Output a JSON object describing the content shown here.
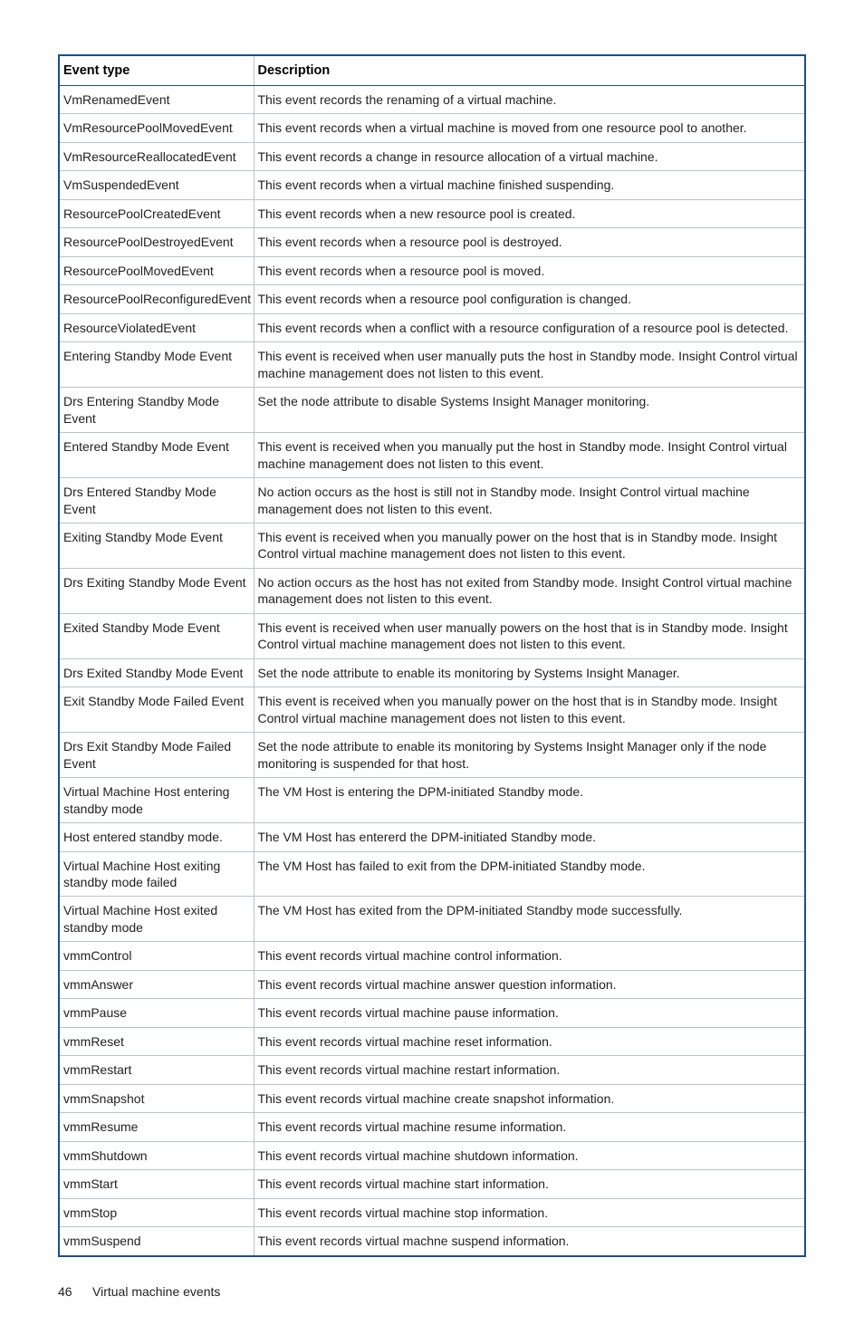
{
  "table": {
    "headers": {
      "event_type": "Event type",
      "description": "Description"
    },
    "rows": [
      {
        "event_type": "VmRenamedEvent",
        "description": "This event records the renaming of a virtual machine."
      },
      {
        "event_type": "VmResourcePoolMovedEvent",
        "description": "This event records when a virtual machine is moved from one resource pool to another."
      },
      {
        "event_type": "VmResourceReallocatedEvent",
        "description": "This event records a change in resource allocation of a virtual machine."
      },
      {
        "event_type": "VmSuspendedEvent",
        "description": "This event records when a virtual machine finished suspending."
      },
      {
        "event_type": "ResourcePoolCreatedEvent",
        "description": "This event records when a new resource pool is created."
      },
      {
        "event_type": "ResourcePoolDestroyedEvent",
        "description": "This event records when a resource pool is destroyed."
      },
      {
        "event_type": "ResourcePoolMovedEvent",
        "description": "This event records when a resource pool is moved."
      },
      {
        "event_type": "ResourcePoolReconfiguredEvent",
        "description": "This event records when a resource pool configuration is changed."
      },
      {
        "event_type": "ResourceViolatedEvent",
        "description": "This event records when a conflict with a resource configuration of a resource pool is detected."
      },
      {
        "event_type": "Entering Standby Mode Event",
        "description": "This event is received when user manually puts the host in Standby mode. Insight Control virtual machine management does not listen to this event."
      },
      {
        "event_type": "Drs Entering Standby Mode Event",
        "description": "Set the node attribute to disable Systems Insight Manager monitoring."
      },
      {
        "event_type": "Entered Standby Mode Event",
        "description": "This event is received when you manually put the host in Standby mode. Insight Control virtual machine management does not listen to this event."
      },
      {
        "event_type": "Drs Entered Standby Mode Event",
        "description": "No action occurs as the host is still not in Standby mode. Insight Control virtual machine management does not listen to this event."
      },
      {
        "event_type": "Exiting Standby Mode Event",
        "description": "This event is received when you manually power on the host that is in Standby mode. Insight Control virtual machine management does not listen to this event."
      },
      {
        "event_type": "Drs Exiting Standby Mode Event",
        "description": "No action occurs as the host has not exited from Standby mode. Insight Control virtual machine management does not listen to this event."
      },
      {
        "event_type": "Exited Standby Mode Event",
        "description": "This event is received when user manually powers on the host that is in Standby mode. Insight Control virtual machine management does not listen to this event."
      },
      {
        "event_type": "Drs Exited Standby Mode Event",
        "description": "Set the node attribute to enable its monitoring by Systems Insight Manager."
      },
      {
        "event_type": "Exit Standby Mode Failed Event",
        "description": "This event is received when you manually power on the host that is in Standby mode. Insight Control virtual machine management does not listen to this event."
      },
      {
        "event_type": "Drs Exit Standby Mode Failed Event",
        "description": "Set the node attribute to enable its monitoring by Systems Insight Manager only if the node monitoring is suspended for that host."
      },
      {
        "event_type": "Virtual Machine Host entering standby mode",
        "description": "The VM Host is entering the DPM-initiated Standby mode."
      },
      {
        "event_type": "Host entered standby mode.",
        "description": "The VM Host has entererd the DPM-initiated Standby mode."
      },
      {
        "event_type": "Virtual Machine Host exiting standby mode failed",
        "description": "The VM Host has failed to exit from the DPM-initiated Standby mode."
      },
      {
        "event_type": "Virtual Machine Host exited standby mode",
        "description": "The VM Host has exited from the DPM-initiated Standby mode successfully."
      },
      {
        "event_type": "vmmControl",
        "description": "This event records virtual machine control information."
      },
      {
        "event_type": "vmmAnswer",
        "description": "This event records virtual machine answer question information."
      },
      {
        "event_type": "vmmPause",
        "description": "This event records virtual machine pause information."
      },
      {
        "event_type": "vmmReset",
        "description": "This event records virtual machine reset information."
      },
      {
        "event_type": "vmmRestart",
        "description": "This event records virtual machine restart information."
      },
      {
        "event_type": "vmmSnapshot",
        "description": "This event records virtual machine create snapshot information."
      },
      {
        "event_type": "vmmResume",
        "description": "This event records virtual machine resume information."
      },
      {
        "event_type": "vmmShutdown",
        "description": "This event records virtual machine shutdown information."
      },
      {
        "event_type": "vmmStart",
        "description": "This event records virtual machine start information."
      },
      {
        "event_type": "vmmStop",
        "description": "This event records virtual machine stop information."
      },
      {
        "event_type": "vmmSuspend",
        "description": "This event records virtual machne suspend information."
      }
    ]
  },
  "footer": {
    "page_number": "46",
    "section_title": "Virtual machine events"
  }
}
